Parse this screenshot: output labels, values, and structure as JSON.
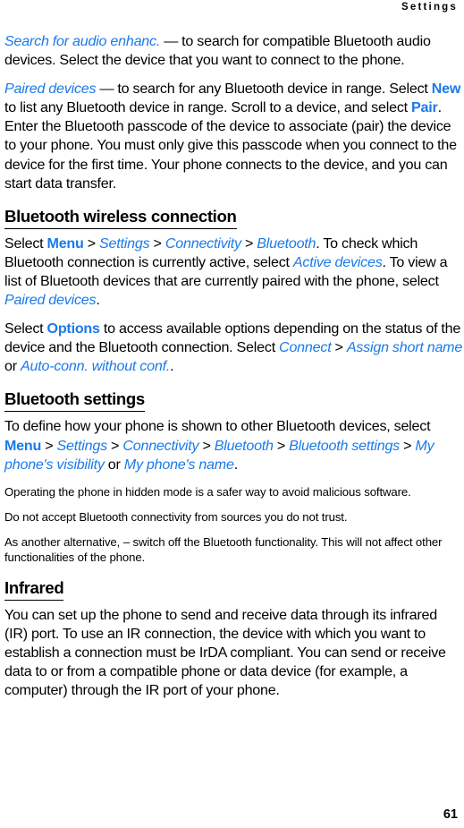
{
  "document": {
    "running_header": "Settings",
    "page_number": "61"
  },
  "colors": {
    "link_blue": "#1a7ae9",
    "text_black": "#000000",
    "page_background": "#ffffff"
  },
  "blocks": [
    {
      "id": "para-search-audio",
      "type": "paragraph",
      "runs": [
        {
          "style": "italic-blue",
          "text": "Search for audio enhanc."
        },
        {
          "style": "plain",
          "text": " — to search for compatible Bluetooth audio devices. Select the device that you want to connect to the phone."
        }
      ]
    },
    {
      "id": "para-paired-devices",
      "type": "paragraph",
      "runs": [
        {
          "style": "italic-blue",
          "text": "Paired devices"
        },
        {
          "style": "plain",
          "text": " — to search for any Bluetooth device in range. Select "
        },
        {
          "style": "bold-blue",
          "text": "New"
        },
        {
          "style": "plain",
          "text": " to list any Bluetooth device in range. Scroll to a device, and select "
        },
        {
          "style": "bold-blue",
          "text": "Pair"
        },
        {
          "style": "plain",
          "text": ". Enter the Bluetooth passcode of the device to associate (pair) the device to your phone. You must only give this passcode when you connect to the device for the first time. Your phone connects to the device, and you can start data transfer."
        }
      ]
    },
    {
      "id": "heading-bluetooth-wireless-connection",
      "type": "heading",
      "text": "Bluetooth wireless connection"
    },
    {
      "id": "para-bt-wireless-1",
      "type": "paragraph",
      "runs": [
        {
          "style": "plain",
          "text": "Select "
        },
        {
          "style": "bold-blue",
          "text": "Menu"
        },
        {
          "style": "separator",
          "text": " > "
        },
        {
          "style": "italic-blue",
          "text": "Settings"
        },
        {
          "style": "separator",
          "text": " > "
        },
        {
          "style": "italic-blue",
          "text": "Connectivity"
        },
        {
          "style": "separator",
          "text": " > "
        },
        {
          "style": "italic-blue",
          "text": "Bluetooth"
        },
        {
          "style": "plain",
          "text": ". To check which Bluetooth connection is currently active, select "
        },
        {
          "style": "italic-blue",
          "text": "Active devices"
        },
        {
          "style": "plain",
          "text": ". To view a list of Bluetooth devices that are currently paired with the phone, select "
        },
        {
          "style": "italic-blue",
          "text": "Paired devices"
        },
        {
          "style": "plain",
          "text": "."
        }
      ]
    },
    {
      "id": "para-bt-wireless-2",
      "type": "paragraph",
      "runs": [
        {
          "style": "plain",
          "text": "Select "
        },
        {
          "style": "bold-blue",
          "text": "Options"
        },
        {
          "style": "plain",
          "text": " to access available options depending on the status of the device and the Bluetooth connection. Select "
        },
        {
          "style": "italic-blue",
          "text": "Connect"
        },
        {
          "style": "separator",
          "text": " > "
        },
        {
          "style": "italic-blue",
          "text": "Assign short name"
        },
        {
          "style": "plain",
          "text": " or "
        },
        {
          "style": "italic-blue",
          "text": "Auto-conn. without conf."
        },
        {
          "style": "plain",
          "text": "."
        }
      ]
    },
    {
      "id": "heading-bluetooth-settings",
      "type": "heading",
      "text": "Bluetooth settings"
    },
    {
      "id": "para-bt-settings-1",
      "type": "paragraph",
      "runs": [
        {
          "style": "plain",
          "text": "To define how your phone is shown to other Bluetooth devices, select "
        },
        {
          "style": "bold-blue",
          "text": "Menu"
        },
        {
          "style": "separator",
          "text": " > "
        },
        {
          "style": "italic-blue",
          "text": "Settings"
        },
        {
          "style": "separator",
          "text": " > "
        },
        {
          "style": "italic-blue",
          "text": "Connectivity"
        },
        {
          "style": "separator",
          "text": " > "
        },
        {
          "style": "italic-blue",
          "text": "Bluetooth"
        },
        {
          "style": "separator",
          "text": " > "
        },
        {
          "style": "italic-blue",
          "text": "Bluetooth settings"
        },
        {
          "style": "separator",
          "text": " > "
        },
        {
          "style": "italic-blue",
          "text": "My phone's visibility"
        },
        {
          "style": "plain",
          "text": " or "
        },
        {
          "style": "italic-blue",
          "text": "My phone's name"
        },
        {
          "style": "plain",
          "text": "."
        }
      ]
    },
    {
      "id": "note-hidden-mode",
      "type": "note",
      "runs": [
        {
          "style": "plain",
          "text": "Operating the phone in hidden mode is a safer way to avoid malicious software."
        }
      ]
    },
    {
      "id": "note-do-not-accept",
      "type": "note",
      "runs": [
        {
          "style": "plain",
          "text": "Do not accept Bluetooth connectivity from sources you do not trust."
        }
      ]
    },
    {
      "id": "note-switch-off",
      "type": "note",
      "runs": [
        {
          "style": "plain",
          "text": "As another alternative, – switch off the Bluetooth functionality.  This will not affect other functionalities of the phone."
        }
      ]
    },
    {
      "id": "heading-infrared",
      "type": "heading",
      "text": "Infrared"
    },
    {
      "id": "para-infrared-1",
      "type": "paragraph",
      "runs": [
        {
          "style": "plain",
          "text": "You can set up the phone to send and receive data through its infrared (IR) port. To use an IR connection, the device with which you want to establish a connection must be IrDA compliant. You can send or receive data to or from a compatible phone or data device (for example, a computer) through the IR port of your phone."
        }
      ]
    }
  ]
}
